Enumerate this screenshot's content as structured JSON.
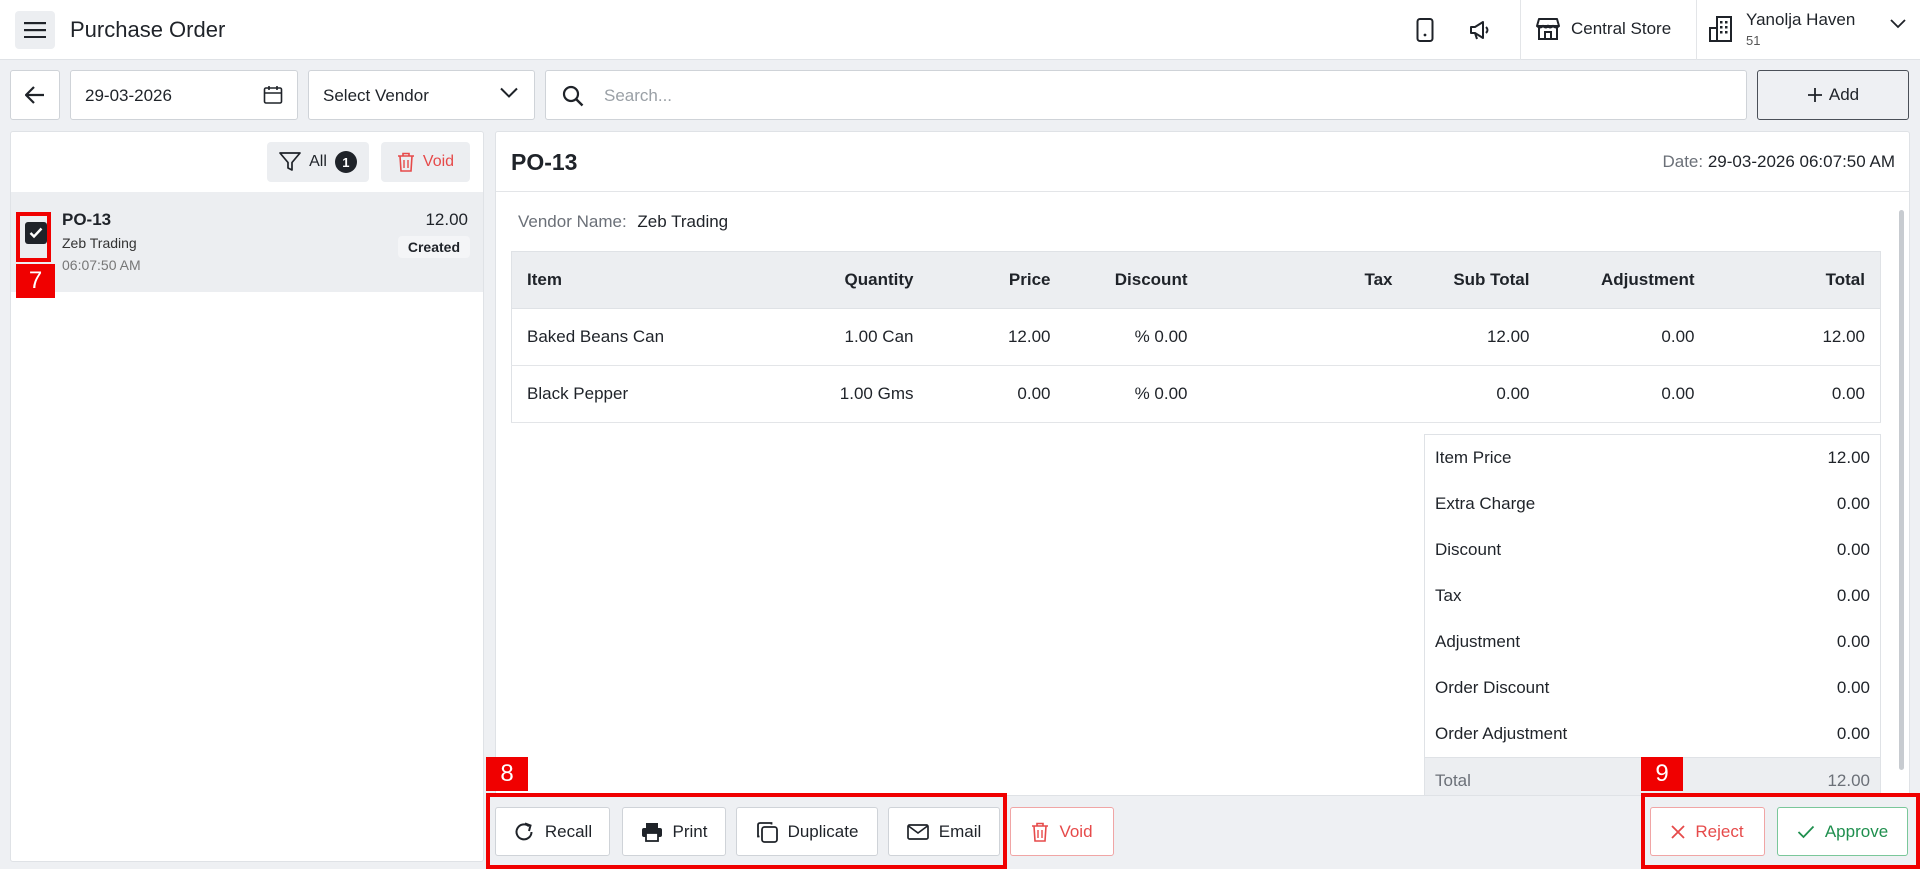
{
  "header": {
    "title": "Purchase Order",
    "store": "Central Store",
    "hotel_name": "Yanolja Haven",
    "hotel_sub": "51"
  },
  "toolbar": {
    "date": "29-03-2026",
    "vendor_select": "Select Vendor",
    "search_placeholder": "Search...",
    "add_label": "Add"
  },
  "list_panel": {
    "filter_label": "All",
    "filter_count": "1",
    "void_label": "Void",
    "orders": [
      {
        "id": "PO-13",
        "vendor": "Zeb Trading",
        "time": "06:07:50 AM",
        "amount": "12.00",
        "status": "Created",
        "checked": true
      }
    ]
  },
  "detail": {
    "title": "PO-13",
    "date_label": "Date:",
    "date_value": "29-03-2026 06:07:50 AM",
    "vendor_label": "Vendor Name:",
    "vendor_value": "Zeb Trading",
    "columns": [
      "Item",
      "Quantity",
      "Price",
      "Discount",
      "Tax",
      "Sub Total",
      "Adjustment",
      "Total"
    ],
    "rows": [
      [
        "Baked Beans Can",
        "1.00 Can",
        "12.00",
        "% 0.00",
        "",
        "12.00",
        "0.00",
        "12.00"
      ],
      [
        "Black Pepper",
        "1.00 Gms",
        "0.00",
        "% 0.00",
        "",
        "0.00",
        "0.00",
        "0.00"
      ]
    ],
    "summary": [
      {
        "label": "Item Price",
        "value": "12.00"
      },
      {
        "label": "Extra Charge",
        "value": "0.00"
      },
      {
        "label": "Discount",
        "value": "0.00"
      },
      {
        "label": "Tax",
        "value": "0.00"
      },
      {
        "label": "Adjustment",
        "value": "0.00"
      },
      {
        "label": "Order Discount",
        "value": "0.00"
      },
      {
        "label": "Order Adjustment",
        "value": "0.00"
      },
      {
        "label": "Total",
        "value": "12.00"
      }
    ]
  },
  "actions": {
    "recall": "Recall",
    "print": "Print",
    "duplicate": "Duplicate",
    "email": "Email",
    "void": "Void",
    "reject": "Reject",
    "approve": "Approve"
  },
  "annotations": {
    "label_7": "7",
    "label_8": "8",
    "label_9": "9"
  },
  "colors": {
    "accent_dark": "#1f2329",
    "danger": "#e64a4a",
    "success": "#1f8f4e",
    "annotation": "#f00000"
  }
}
